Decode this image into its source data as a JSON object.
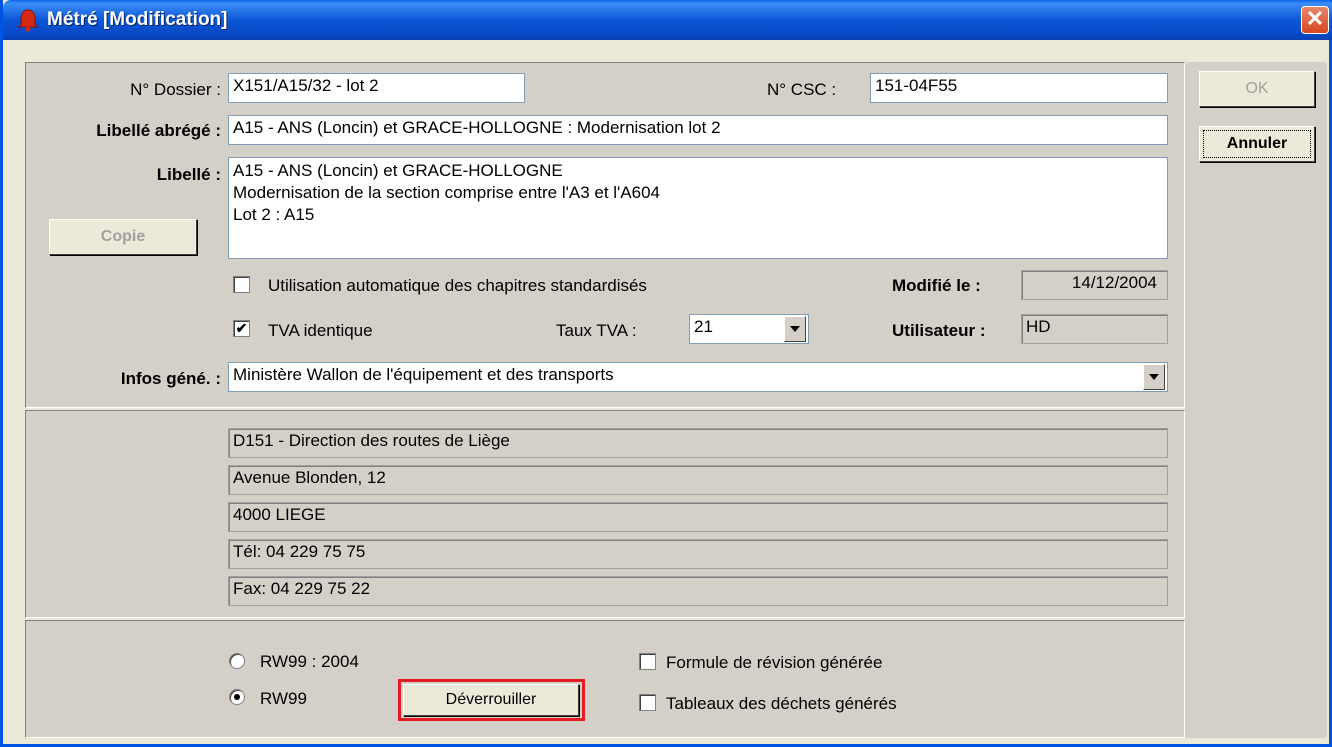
{
  "window": {
    "title": "Métré [Modification]",
    "close_icon": "close-icon"
  },
  "form": {
    "dossier_label": "N° Dossier :",
    "dossier_value": "X151/A15/32 - lot 2",
    "csc_label": "N° CSC :",
    "csc_value": "151-04F55",
    "libelle_abrege_label": "Libellé abrégé :",
    "libelle_abrege_value": "A15 - ANS (Loncin) et GRACE-HOLLOGNE : Modernisation lot 2",
    "libelle_label": "Libellé :",
    "libelle_lines": [
      "A15 - ANS (Loncin) et GRACE-HOLLOGNE",
      "Modernisation de la section comprise entre l'A3 et l'A604",
      "Lot 2 : A15"
    ],
    "copie_label": "Copie",
    "chapitres_label": "Utilisation automatique des chapitres standardisés",
    "chapitres_checked": false,
    "modifie_label": "Modifié le :",
    "modifie_value": "14/12/2004",
    "tva_identique_label": "TVA identique",
    "tva_identique_checked": true,
    "taux_tva_label": "Taux TVA :",
    "taux_tva_value": "21",
    "utilisateur_label": "Utilisateur :",
    "utilisateur_value": "HD",
    "infos_label": "Infos géné. :",
    "infos_value": "Ministère Wallon de l'équipement et des transports"
  },
  "address": {
    "lines": [
      "D151 - Direction des routes de Liège",
      "Avenue Blonden, 12",
      "4000 LIEGE",
      "Tél: 04 229 75 75",
      "Fax: 04 229 75 22"
    ]
  },
  "bottom": {
    "radio_2004_label": "RW99 : 2004",
    "radio_rw99_label": "RW99",
    "selected_radio": "RW99",
    "deverrouiller_label": "Déverrouiller",
    "formule_label": "Formule de révision générée",
    "dechets_label": "Tableaux des déchets générés"
  },
  "actions": {
    "ok_label": "OK",
    "annuler_label": "Annuler"
  },
  "colors": {
    "titlebar": "#0b57d6",
    "highlight": "#e31b23",
    "panel": "#d4d0c8"
  }
}
